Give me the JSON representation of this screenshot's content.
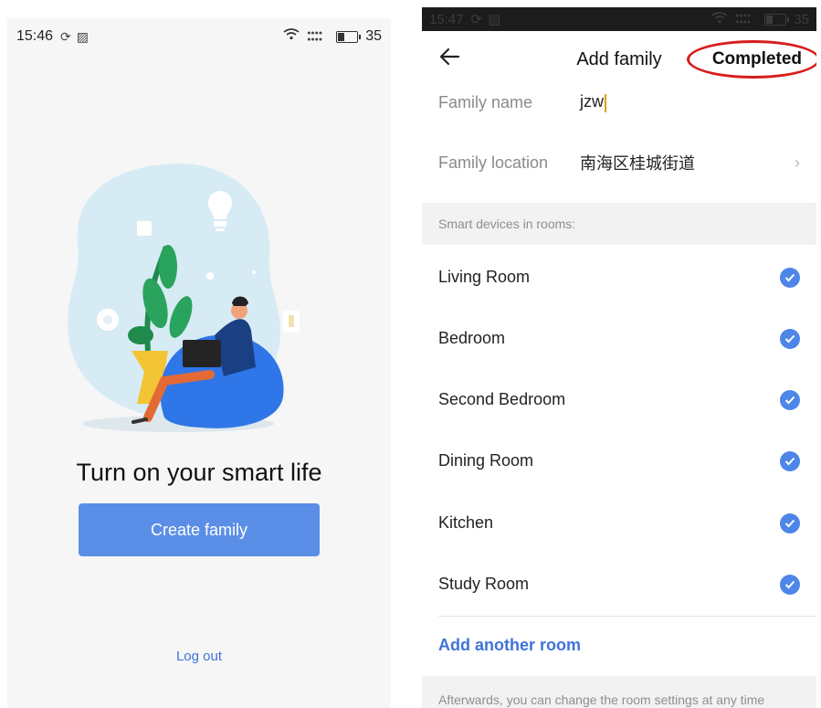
{
  "left": {
    "status": {
      "time": "15:46",
      "battery": "35"
    },
    "hero_title": "Turn on your smart life",
    "create_button": "Create family",
    "logout": "Log out"
  },
  "right": {
    "status": {
      "time": "15:47",
      "battery": "35"
    },
    "title": "Add family",
    "completed": "Completed",
    "family_name_label": "Family name",
    "family_name_value": "jzw",
    "family_location_label": "Family location",
    "family_location_value": "南海区桂城街道",
    "section_label": "Smart devices in rooms:",
    "rooms": [
      "Living Room",
      "Bedroom",
      "Second Bedroom",
      "Dining Room",
      "Kitchen",
      "Study Room"
    ],
    "add_room": "Add another room",
    "footer_note": "Afterwards, you can change the room settings at any time"
  },
  "colors": {
    "accent": "#5b8ee6",
    "link": "#3f73d9",
    "check": "#4d86e8",
    "annotation": "#d81c1c"
  }
}
